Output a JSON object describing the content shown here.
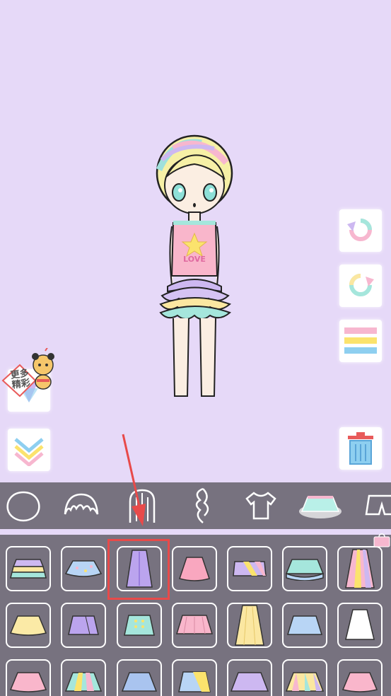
{
  "app": {
    "background_color": "#e6d9f8",
    "panel_color": "#77727f",
    "highlight_color": "#e84a4a"
  },
  "character": {
    "shirt_text": "LOVE"
  },
  "side_buttons": {
    "undo": {
      "icon": "undo-arrow-icon"
    },
    "redo": {
      "icon": "redo-arrow-icon"
    },
    "menu": {
      "icon": "menu-bars-icon"
    },
    "collapse": {
      "icon": "chevron-down-icon"
    },
    "trash": {
      "icon": "trash-icon"
    }
  },
  "promo": {
    "label": "更多精彩",
    "icon": "tiger-mascot-icon"
  },
  "categories": [
    {
      "name": "face",
      "icon": "face-outline-icon"
    },
    {
      "name": "hair-front",
      "icon": "hair-bangs-icon"
    },
    {
      "name": "hair-back",
      "icon": "hair-long-icon"
    },
    {
      "name": "hair-side",
      "icon": "hair-ponytail-icon"
    },
    {
      "name": "top",
      "icon": "shirt-icon"
    },
    {
      "name": "skirt",
      "icon": "skirt-icon",
      "selected": true
    },
    {
      "name": "pants",
      "icon": "shorts-icon"
    }
  ],
  "items": [
    {
      "icon": "tiered-skirt-icon"
    },
    {
      "icon": "tutu-skirt-icon"
    },
    {
      "icon": "long-purple-skirt-icon"
    },
    {
      "icon": "pink-flare-skirt-icon"
    },
    {
      "icon": "stripe-mini-skirt-icon"
    },
    {
      "icon": "frill-blue-skirt-icon"
    },
    {
      "icon": "pastel-maxi-skirt-icon"
    },
    {
      "icon": "yellow-puff-skirt-icon"
    },
    {
      "icon": "purple-wrap-skirt-icon"
    },
    {
      "icon": "mint-button-skirt-icon"
    },
    {
      "icon": "pink-pleat-skirt-icon"
    },
    {
      "icon": "yellow-midi-skirt-icon"
    },
    {
      "icon": "blue-pleat-skirt-icon"
    },
    {
      "icon": "white-skirt-icon"
    },
    {
      "icon": "pink-ruffle-skirt-icon"
    },
    {
      "icon": "rainbow-pleat-skirt-icon"
    },
    {
      "icon": "blue-flare-skirt-icon"
    },
    {
      "icon": "diagonal-stripe-skirt-icon"
    },
    {
      "icon": "lavender-pleat-skirt-icon"
    },
    {
      "icon": "rainbow-frill-skirt-icon"
    },
    {
      "icon": "pink-bubble-skirt-icon"
    }
  ],
  "selected_item_index": 2
}
